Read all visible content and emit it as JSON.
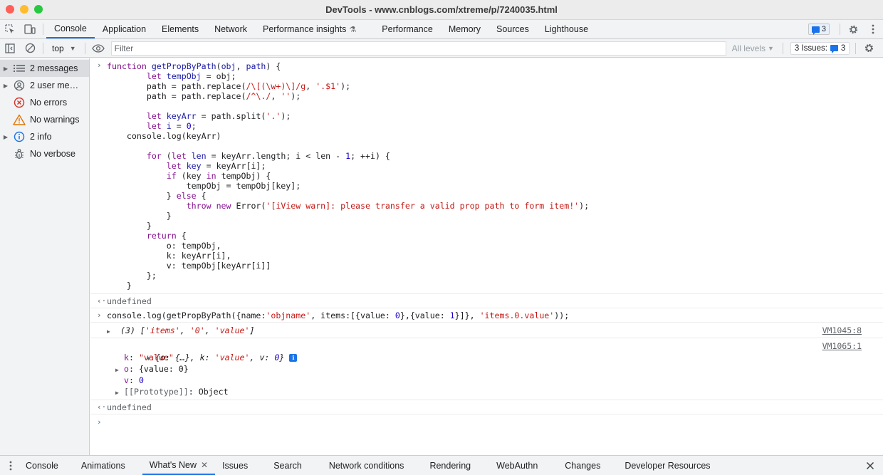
{
  "window": {
    "title": "DevTools - www.cnblogs.com/xtreme/p/7240035.html",
    "traffic_lights": [
      "#ff5f57",
      "#febc2e",
      "#28c840"
    ]
  },
  "main_tabs": [
    {
      "label": "Console",
      "active": true
    },
    {
      "label": "Application"
    },
    {
      "label": "Elements"
    },
    {
      "label": "Network"
    },
    {
      "label": "Performance insights"
    },
    {
      "label": "Performance"
    },
    {
      "label": "Memory"
    },
    {
      "label": "Sources"
    },
    {
      "label": "Lighthouse"
    }
  ],
  "issues_badge_count": "3",
  "toolbar": {
    "context": "top",
    "filter_placeholder": "Filter",
    "levels": "All levels",
    "issues_label": "3 Issues:",
    "issues_count": "3"
  },
  "sidebar": {
    "items": [
      {
        "label": "2 messages",
        "icon": "list-icon",
        "selected": true
      },
      {
        "label": "2 user me…",
        "icon": "user-icon"
      },
      {
        "label": "No errors",
        "icon": "error-icon"
      },
      {
        "label": "No warnings",
        "icon": "warning-icon"
      },
      {
        "label": "2 info",
        "icon": "info-icon"
      },
      {
        "label": "No verbose",
        "icon": "bug-icon"
      }
    ]
  },
  "console": {
    "input_prompt": ">",
    "result_prompt": "<·",
    "code_lines": [
      "function getPropByPath(obj, path) {",
      "        let tempObj = obj;",
      "        path = path.replace(/\\[(\\w+)\\]/g, '.$1');",
      "        path = path.replace(/^\\./, '');",
      "",
      "        let keyArr = path.split('.');",
      "        let i = 0;",
      "    console.log(keyArr)",
      "",
      "        for (let len = keyArr.length; i < len - 1; ++i) {",
      "            let key = keyArr[i];",
      "            if (key in tempObj) {",
      "                tempObj = tempObj[key];",
      "            } else {",
      "                throw new Error('[iView warn]: please transfer a valid prop path to form item!');",
      "            }",
      "        }",
      "        return {",
      "            o: tempObj,",
      "            k: keyArr[i],",
      "            v: tempObj[keyArr[i]]",
      "        };",
      "    }"
    ],
    "result1": "undefined",
    "call_line": "console.log(getPropByPath({name:'objname', items:[{value: 0},{value: 1}]}, 'items.0.value'));",
    "log1": {
      "text": "(3) ['items', '0', 'value']",
      "source": "VM1045:8"
    },
    "log2": {
      "summary": "{o: {…}, k: 'value', v: 0}",
      "source": "VM1065:1",
      "props": [
        {
          "key": "k",
          "sep": ": ",
          "value": "\"value\"",
          "expandable": false
        },
        {
          "key": "o",
          "sep": ": ",
          "value": "{value: 0}",
          "expandable": true
        },
        {
          "key": "v",
          "sep": ": ",
          "value": "0",
          "expandable": false
        },
        {
          "key": "[[Prototype]]",
          "sep": ": ",
          "value": "Object",
          "expandable": true
        }
      ]
    },
    "result2": "undefined"
  },
  "drawer_tabs": [
    {
      "label": "Console"
    },
    {
      "label": "Animations"
    },
    {
      "label": "What's New",
      "active": true,
      "closable": true
    },
    {
      "label": "Issues"
    },
    {
      "label": "Search"
    },
    {
      "label": "Network conditions"
    },
    {
      "label": "Rendering"
    },
    {
      "label": "WebAuthn"
    },
    {
      "label": "Changes"
    },
    {
      "label": "Developer Resources"
    }
  ]
}
